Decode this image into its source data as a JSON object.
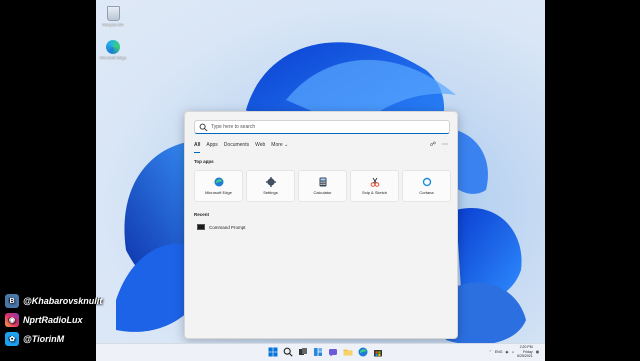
{
  "desktop": {
    "icons": [
      {
        "label": "Recycle Bin"
      },
      {
        "label": "Microsoft Edge"
      }
    ]
  },
  "start_menu": {
    "search_placeholder": "Type here to search",
    "tabs": [
      "All",
      "Apps",
      "Documents",
      "Web",
      "More"
    ],
    "top_apps_title": "Top apps",
    "top_apps": [
      "Microsoft Edge",
      "Settings",
      "Calculator",
      "Snip & Sketch",
      "Cortana"
    ],
    "recent_title": "Recent",
    "recent": [
      "Command Prompt"
    ]
  },
  "taskbar": {
    "language": "ENG",
    "time": "2:20 PM",
    "day": "Friday",
    "date": "6/25/2021"
  },
  "social": [
    {
      "icon": "vk-icon",
      "handle": "@Khabarovsknulit"
    },
    {
      "icon": "instagram-icon",
      "handle": "NprtRadioLux"
    },
    {
      "icon": "twitter-icon",
      "handle": "@TiorinM"
    }
  ],
  "colors": {
    "accent": "#0067c0",
    "bloom": "#1a5fe0"
  }
}
